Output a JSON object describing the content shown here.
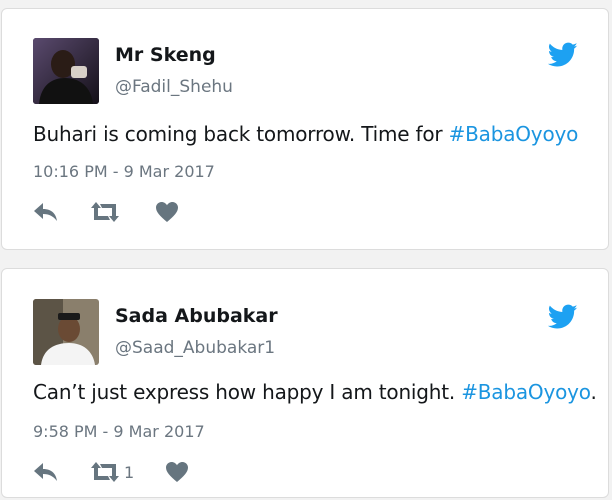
{
  "colors": {
    "brand": "#1da1f2",
    "hashtag": "#1b95e0",
    "icon": "#66757f",
    "text": "#14171a",
    "secondary": "#6b7680"
  },
  "tweets": [
    {
      "display_name": "Mr Skeng",
      "handle": "@Fadil_Shehu",
      "text": "Buhari is coming back tomorrow. Time for ",
      "hashtag": "#BabaOyoyo",
      "text_after": "",
      "timestamp": "10:16 PM - 9 Mar 2017",
      "retweet_count": "",
      "icons": [
        "twitter-bird-icon",
        "reply-icon",
        "retweet-icon",
        "like-heart-icon"
      ]
    },
    {
      "display_name": "Sada Abubakar",
      "handle": "@Saad_Abubakar1",
      "text": "Can’t just express how happy I am tonight. ",
      "hashtag": "#BabaOyoyo",
      "text_after": ".",
      "timestamp": "9:58 PM - 9 Mar 2017",
      "retweet_count": "1",
      "icons": [
        "twitter-bird-icon",
        "reply-icon",
        "retweet-icon",
        "like-heart-icon"
      ]
    }
  ]
}
